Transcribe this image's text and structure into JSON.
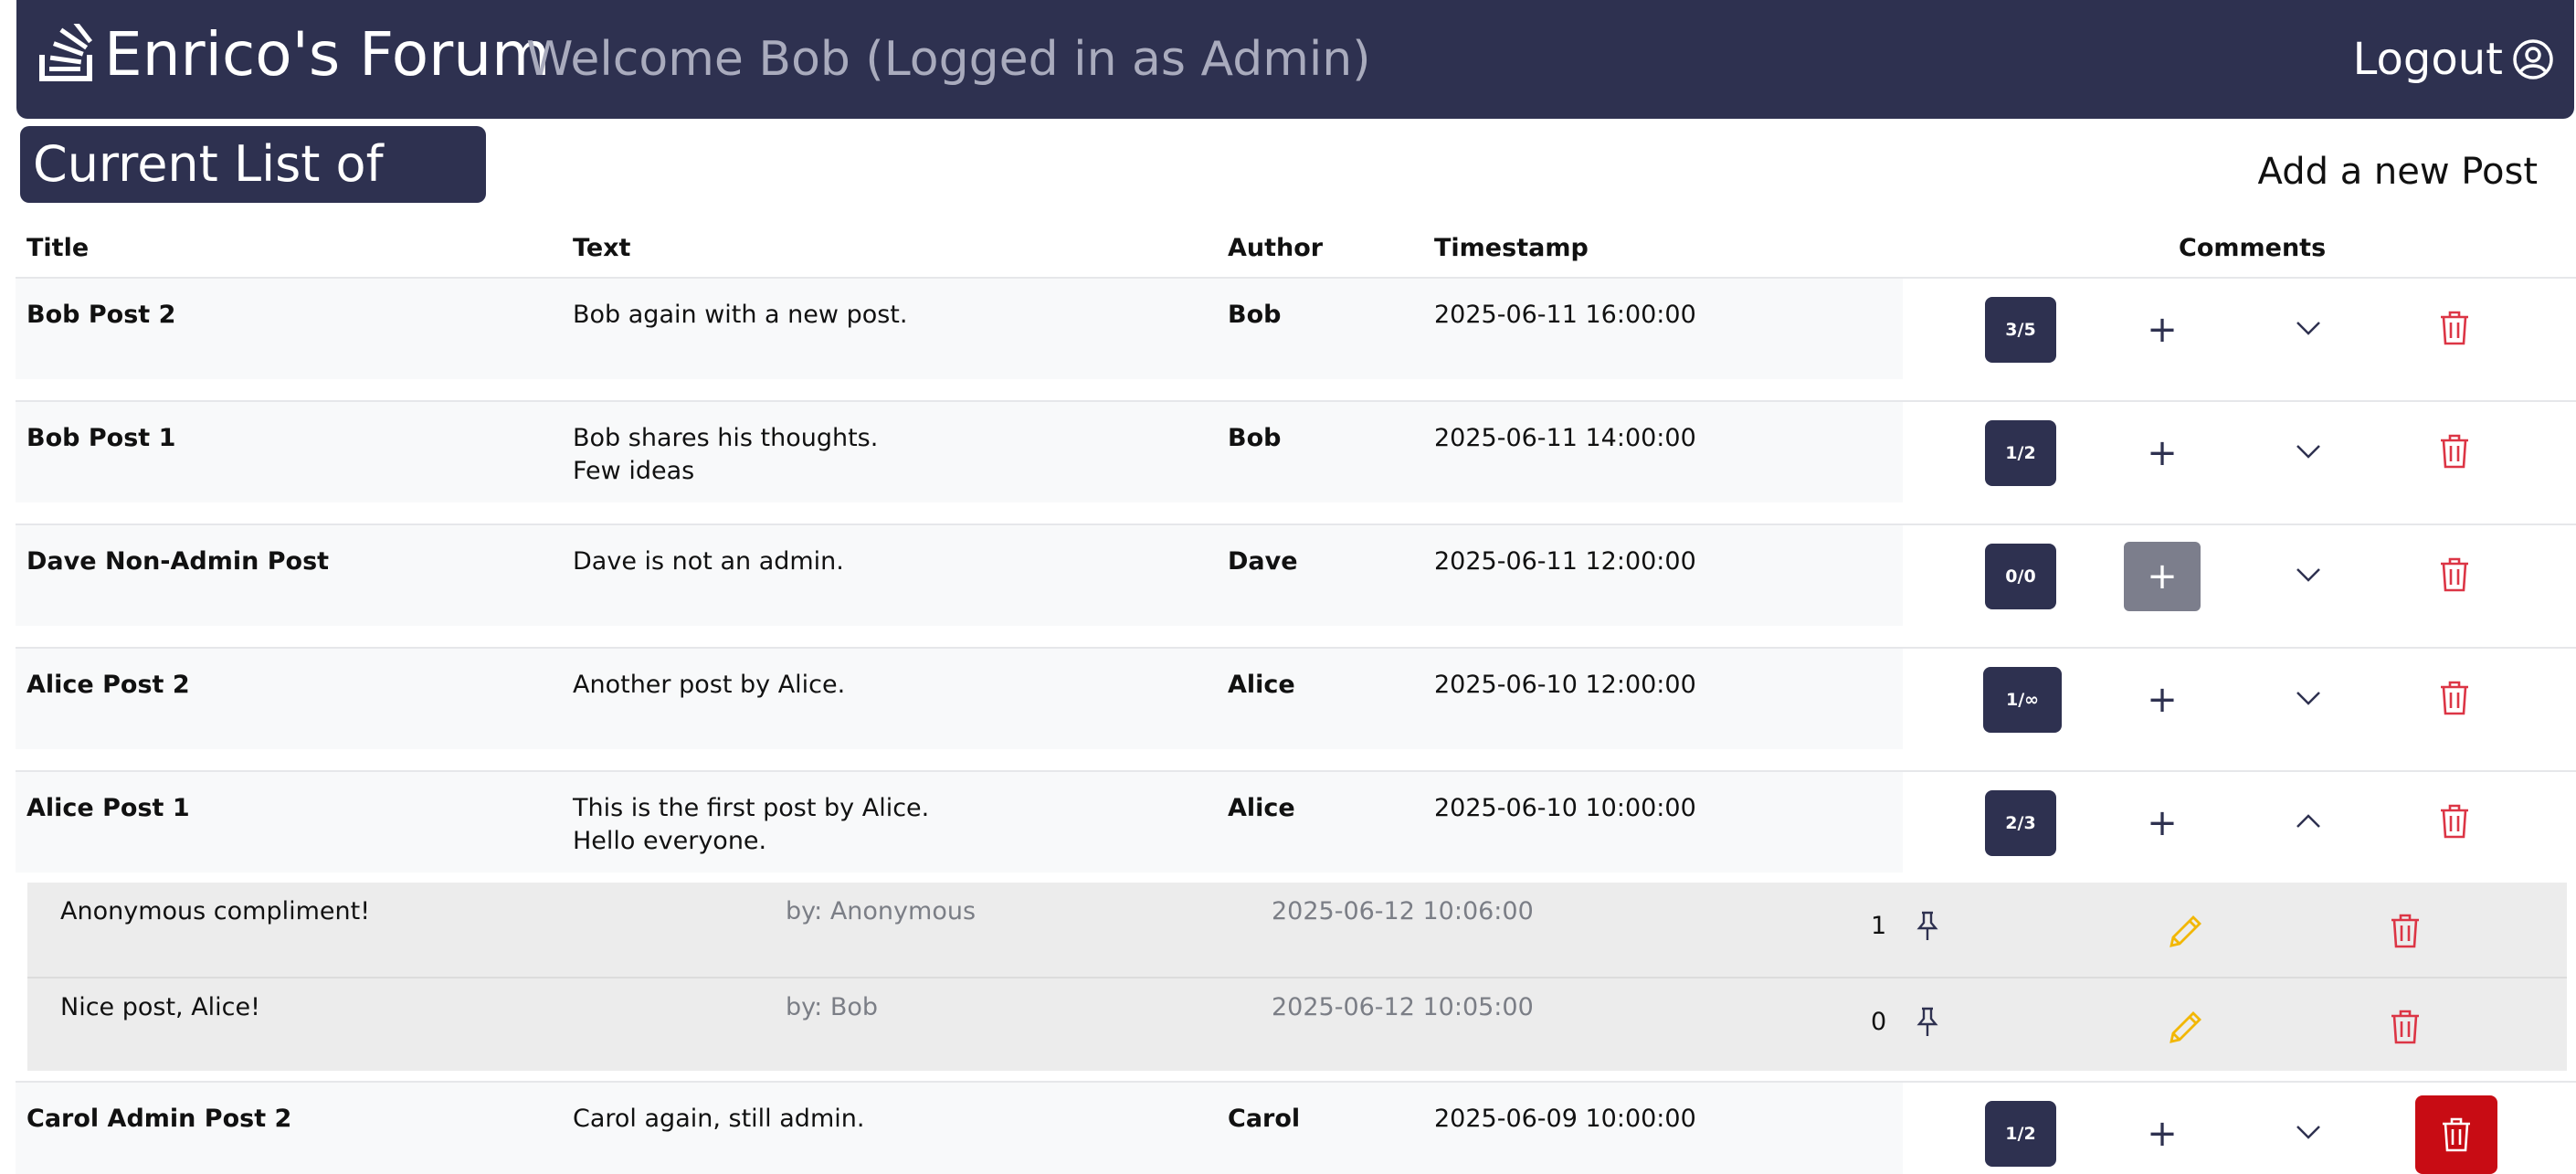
{
  "header": {
    "brand": "Enrico's Forum",
    "welcome": "Welcome Bob (Logged in as Admin)",
    "logout_label": "Logout",
    "brand_icon": "stack-icon",
    "logout_icon": "user-circle-icon"
  },
  "main": {
    "title": "Current List of Posts",
    "add_post_label": "Add a new Post"
  },
  "table": {
    "headers": {
      "title": "Title",
      "text": "Text",
      "author": "Author",
      "timestamp": "Timestamp",
      "comments": "Comments"
    },
    "rows": [
      {
        "title": "Bob Post 2",
        "text_line1": "Bob again with a new post.",
        "text_line2": "",
        "author": "Bob",
        "timestamp": "2025-06-11 16:00:00",
        "comments": "3/5"
      },
      {
        "title": "Bob Post 1",
        "text_line1": "Bob shares his thoughts.",
        "text_line2": "Few ideas",
        "author": "Bob",
        "timestamp": "2025-06-11 14:00:00",
        "comments": "1/2"
      },
      {
        "title": "Dave Non-Admin Post",
        "text_line1": "Dave is not an admin.",
        "text_line2": "",
        "author": "Dave",
        "timestamp": "2025-06-11 12:00:00",
        "comments": "0/0"
      },
      {
        "title": "Alice Post 2",
        "text_line1": "Another post by Alice.",
        "text_line2": "",
        "author": "Alice",
        "timestamp": "2025-06-10 12:00:00",
        "comments": "1/∞"
      },
      {
        "title": "Alice Post 1",
        "text_line1": "This is the first post by Alice.",
        "text_line2": "Hello everyone.",
        "author": "Alice",
        "timestamp": "2025-06-10 10:00:00",
        "comments": "2/3"
      },
      {
        "title": "Carol Admin Post 2",
        "text_line1": "Carol again, still admin.",
        "text_line2": "",
        "author": "Carol",
        "timestamp": "2025-06-09 10:00:00",
        "comments": "1/2"
      }
    ],
    "expanded_comments": [
      {
        "text": "Anonymous compliment!",
        "by": "by: Anonymous",
        "timestamp": "2025-06-12 10:06:00",
        "count": "1"
      },
      {
        "text": "Nice post, Alice!",
        "by": "by: Bob",
        "timestamp": "2025-06-12 10:05:00",
        "count": "0"
      }
    ]
  },
  "colors": {
    "navy": "#2e3150",
    "danger": "#c80c14",
    "warning": "#f2b705",
    "muted": "#7b7e86"
  },
  "icons": {
    "add": "plus-icon",
    "expand": "chevron-down-icon",
    "collapse": "chevron-up-icon",
    "delete": "trash-icon",
    "pin": "pin-icon",
    "edit": "pencil-icon"
  }
}
